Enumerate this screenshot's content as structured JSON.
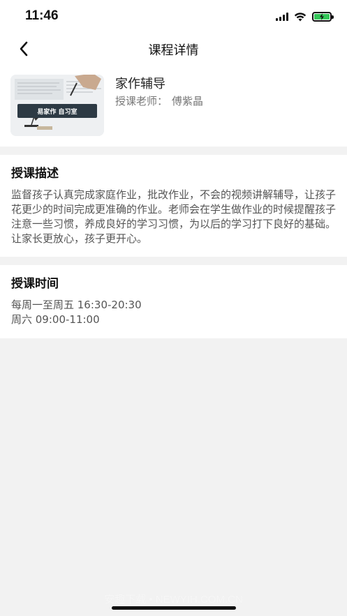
{
  "status_bar": {
    "time": "11:46"
  },
  "nav": {
    "title": "课程详情"
  },
  "course": {
    "title": "家作辅导",
    "teacher_label": "授课老师：",
    "teacher_name": "傅紫晶",
    "thumbnail_banner": "易家作 自习室"
  },
  "description": {
    "title": "授课描述",
    "text": "监督孩子认真完成家庭作业，批改作业，不会的视频讲解辅导，让孩子花更少的时间完成更准确的作业。老师会在学生做作业的时候提醒孩子注意一些习惯，养成良好的学习习惯，为以后的学习打下良好的基础。让家长更放心，孩子更开心。"
  },
  "schedule": {
    "title": "授课时间",
    "lines": [
      "每周一至周五 16:30-20:30",
      "周六 09:00-11:00"
    ]
  },
  "watermark": "安趣下载 • NEWYIH.COM.CN",
  "colors": {
    "background": "#f2f2f2",
    "card": "#ffffff",
    "battery": "#34c759"
  }
}
